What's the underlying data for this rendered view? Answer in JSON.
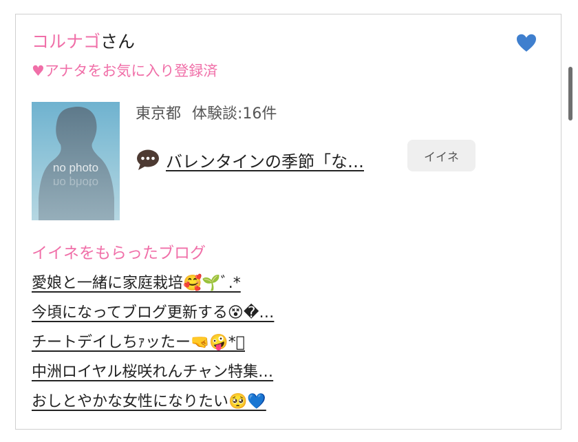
{
  "profile": {
    "name": "コルナゴ",
    "honorific": "さん",
    "favorite_status": "♥アナタをお気に入り登録済",
    "heart_color": "#3f7fce",
    "avatar_placeholder": "no photo",
    "location": "東京都",
    "reviews": "体験談:16件"
  },
  "latest_post": {
    "icon": "speech-bubble-icon",
    "title": "バレンタインの季節「な…",
    "like_label": "イイネ"
  },
  "liked_blogs": {
    "title": "イイネをもらったブログ",
    "items": [
      "愛娘と一緒に家庭栽培🥰🌱ﾞ.*",
      "今頃になってブログ更新する😵�…",
      "チートデイしちｧッたー🤜🤪*ﾟ",
      "中洲ロイヤル桜咲れんチャン特集…",
      "おしとやかな女性になりたい🥺💙"
    ]
  },
  "colors": {
    "accent_pink": "#f06fa8",
    "border": "#cfcfcf",
    "button_bg": "#efefef"
  }
}
